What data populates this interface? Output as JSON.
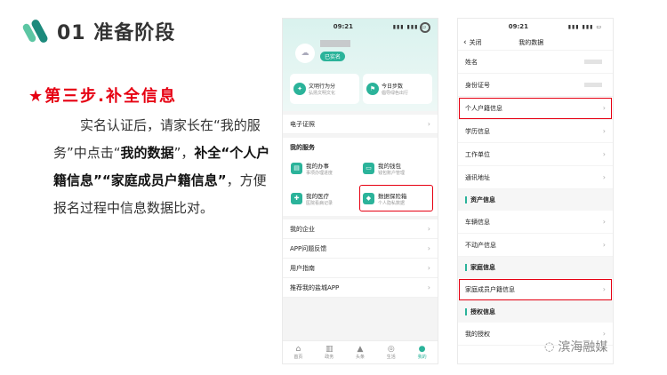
{
  "header": {
    "title": "01 准备阶段"
  },
  "step": {
    "title": "★第三步.补全信息"
  },
  "paragraph": {
    "p1": "实名认证后，请家长在“我的服务”中点击“",
    "b1": "我的数据",
    "p2": "”，",
    "b2": "补全“个人户籍信息”“家庭成员户籍信息”",
    "p3": "，方便报名过程中信息数据比对。"
  },
  "phone1": {
    "time": "09:21",
    "verified": "已实名",
    "cards": [
      {
        "title": "文明行为分",
        "sub": "弘扬文明文化"
      },
      {
        "title": "今日步数",
        "sub": "倡导绿色出行"
      }
    ],
    "rows_top": [
      {
        "label": "电子证照"
      }
    ],
    "services_title": "我的服务",
    "services": [
      {
        "title": "我的办事",
        "sub": "事项办理进度"
      },
      {
        "title": "我的钱包",
        "sub": "钱包账户管理"
      },
      {
        "title": "我的医疗",
        "sub": "医院看病记录"
      },
      {
        "title": "数据保险箱",
        "sub": "个人隐私数据"
      }
    ],
    "rows_bottom": [
      {
        "label": "我的企业"
      },
      {
        "label": "APP问题反馈"
      },
      {
        "label": "用户指南"
      },
      {
        "label": "推荐我的盐城APP"
      }
    ],
    "tabs": [
      "首页",
      "政务",
      "头条",
      "生活",
      "我的"
    ]
  },
  "phone2": {
    "time": "09:21",
    "back": "关闭",
    "title": "我的数据",
    "rows": [
      {
        "label": "姓名"
      },
      {
        "label": "身份证号"
      },
      {
        "label": "个人户籍信息"
      },
      {
        "label": "学历信息"
      },
      {
        "label": "工作单位"
      },
      {
        "label": "通讯地址"
      }
    ],
    "group_asset": "资产信息",
    "asset_rows": [
      {
        "label": "车辆信息"
      },
      {
        "label": "不动产信息"
      }
    ],
    "group_family": "家庭信息",
    "family_rows": [
      {
        "label": "家庭成员户籍信息"
      }
    ],
    "group_auth": "授权信息",
    "auth_rows": [
      {
        "label": "我的授权"
      }
    ]
  },
  "watermark": {
    "text": "滨海融媒"
  }
}
